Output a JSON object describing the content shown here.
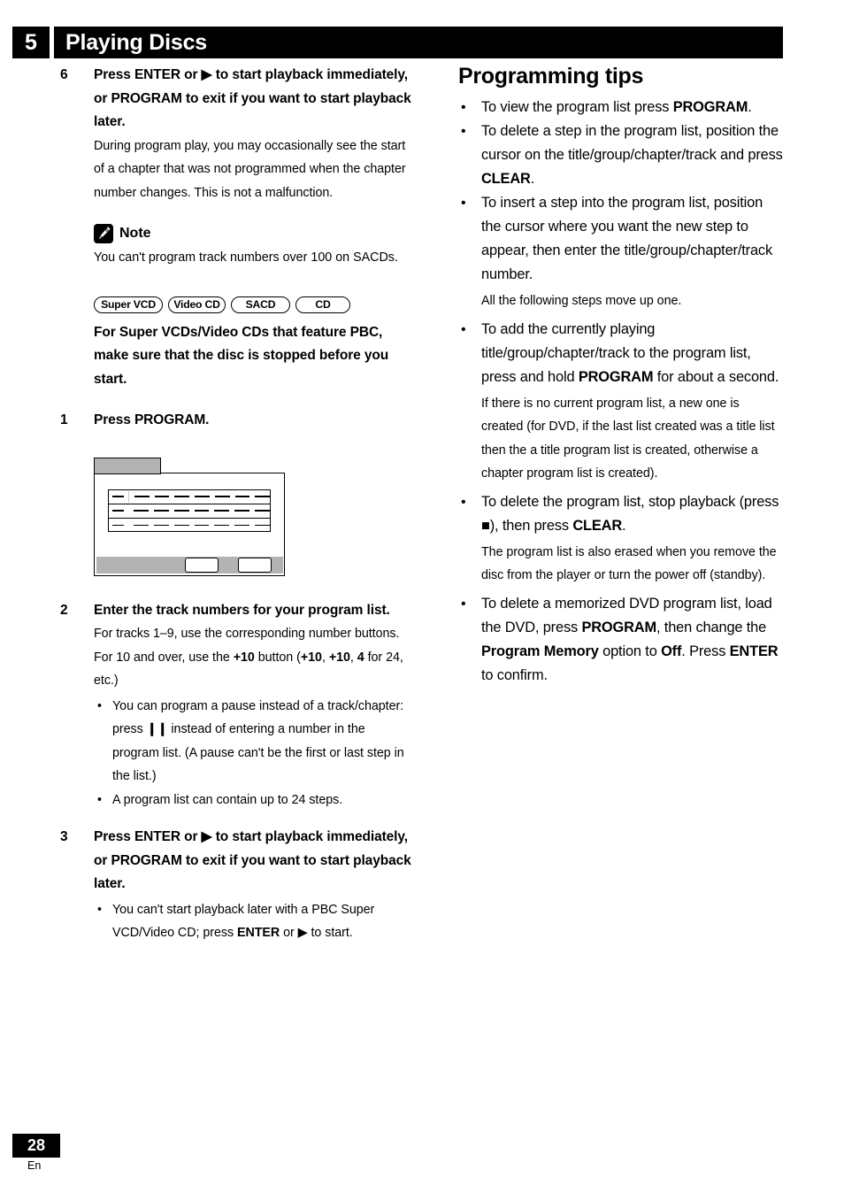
{
  "header": {
    "chapter_number": "5",
    "chapter_title": "Playing Discs"
  },
  "left_column": {
    "step6": {
      "number": "6",
      "heading": "Press ENTER or ▶ to start playback immediately, or PROGRAM to exit if you want to start playback later.",
      "body": "During program play, you may occasionally see the start of a chapter that was not programmed when the chapter number changes. This is not a malfunction."
    },
    "note": {
      "icon": "pencil-icon",
      "title": "Note",
      "text": "You can't program track numbers over 100 on SACDs."
    },
    "disc_badges": [
      {
        "label": "Super VCD",
        "key": "super-vcd"
      },
      {
        "label": "Video CD",
        "key": "video-cd"
      },
      {
        "label": "SACD",
        "key": "sacd"
      },
      {
        "label": "CD",
        "key": "cd"
      }
    ],
    "pbc_paragraph": "For Super VCDs/Video CDs that feature PBC, make sure that the disc is stopped before you start.",
    "step1": {
      "number": "1",
      "heading": "Press PROGRAM."
    },
    "osd_illustration": {
      "name": "program-list-osd",
      "tab_color": "#b3b3b3",
      "footer_color": "#b3b3b3",
      "rows": 3,
      "buttons": 2
    },
    "step2": {
      "number": "2",
      "heading": "Enter the track numbers for your program list.",
      "body_prefix": "For tracks 1–9, use the corresponding number buttons. For 10 and over, use the ",
      "body_bold1": "+10",
      "body_mid1": " button (",
      "body_bold2": "+10",
      "body_mid2": ", ",
      "body_bold3": "+10",
      "body_mid3": ", ",
      "body_bold4": "4",
      "body_suffix": " for 24, etc.)",
      "bullets": [
        {
          "part1": "You can program a pause instead of a track/chapter: press ",
          "symbol": "❙❙",
          "part2": " instead of entering a number in the program list. (A pause can't be the first or last step in the list.)"
        },
        {
          "part1": "A program list can contain up to 24 steps.",
          "symbol": "",
          "part2": ""
        }
      ]
    },
    "step3": {
      "number": "3",
      "heading": "Press ENTER or ▶ to start playback immediately, or PROGRAM to exit if you want to start playback later.",
      "bullet_part1": "You can't start playback later with a PBC Super VCD/Video CD; press ",
      "bullet_bold": "ENTER",
      "bullet_part2": " or ▶ to start."
    }
  },
  "right_column": {
    "title": "Programming tips",
    "tips": [
      {
        "part1": "To view the program list press ",
        "bold1": "PROGRAM",
        "part2": ".",
        "note": ""
      },
      {
        "part1": "To delete a step in the program list, position the cursor on the title/group/chapter/track and press ",
        "bold1": "CLEAR",
        "part2": ".",
        "note": ""
      },
      {
        "part1": "To insert a step into the program list, position the cursor where you want the new step to appear, then enter the title/group/chapter/track number.",
        "bold1": "",
        "part2": "",
        "note": "All the following steps move up one."
      },
      {
        "part1": "To add the currently playing title/group/chapter/track to the program list, press and hold ",
        "bold1": "PROGRAM",
        "part2": " for about a second.",
        "note": "If there is no current program list, a new one is created (for DVD, if the last list created was a title list then the a title program list is created, otherwise a chapter program list is created)."
      },
      {
        "part1": "To delete the program list, stop playback (press ■), then press ",
        "bold1": "CLEAR",
        "part2": ".",
        "note": "The program list is also erased when you remove the disc from the player or turn the power off (standby)."
      },
      {
        "part1": "To delete a memorized DVD program list, load the DVD, press ",
        "bold1": "PROGRAM",
        "part2": ", then change the ",
        "bold2": "Program Memory",
        "part3": " option to ",
        "bold3": "Off",
        "part4": ". Press ",
        "bold4": "ENTER",
        "part5": " to confirm.",
        "note": ""
      }
    ]
  },
  "footer": {
    "page_number": "28",
    "language": "En"
  },
  "colors": {
    "header_bg": "#000000",
    "header_text": "#ffffff",
    "osd_gray": "#b3b3b3",
    "body_text": "#000000"
  }
}
